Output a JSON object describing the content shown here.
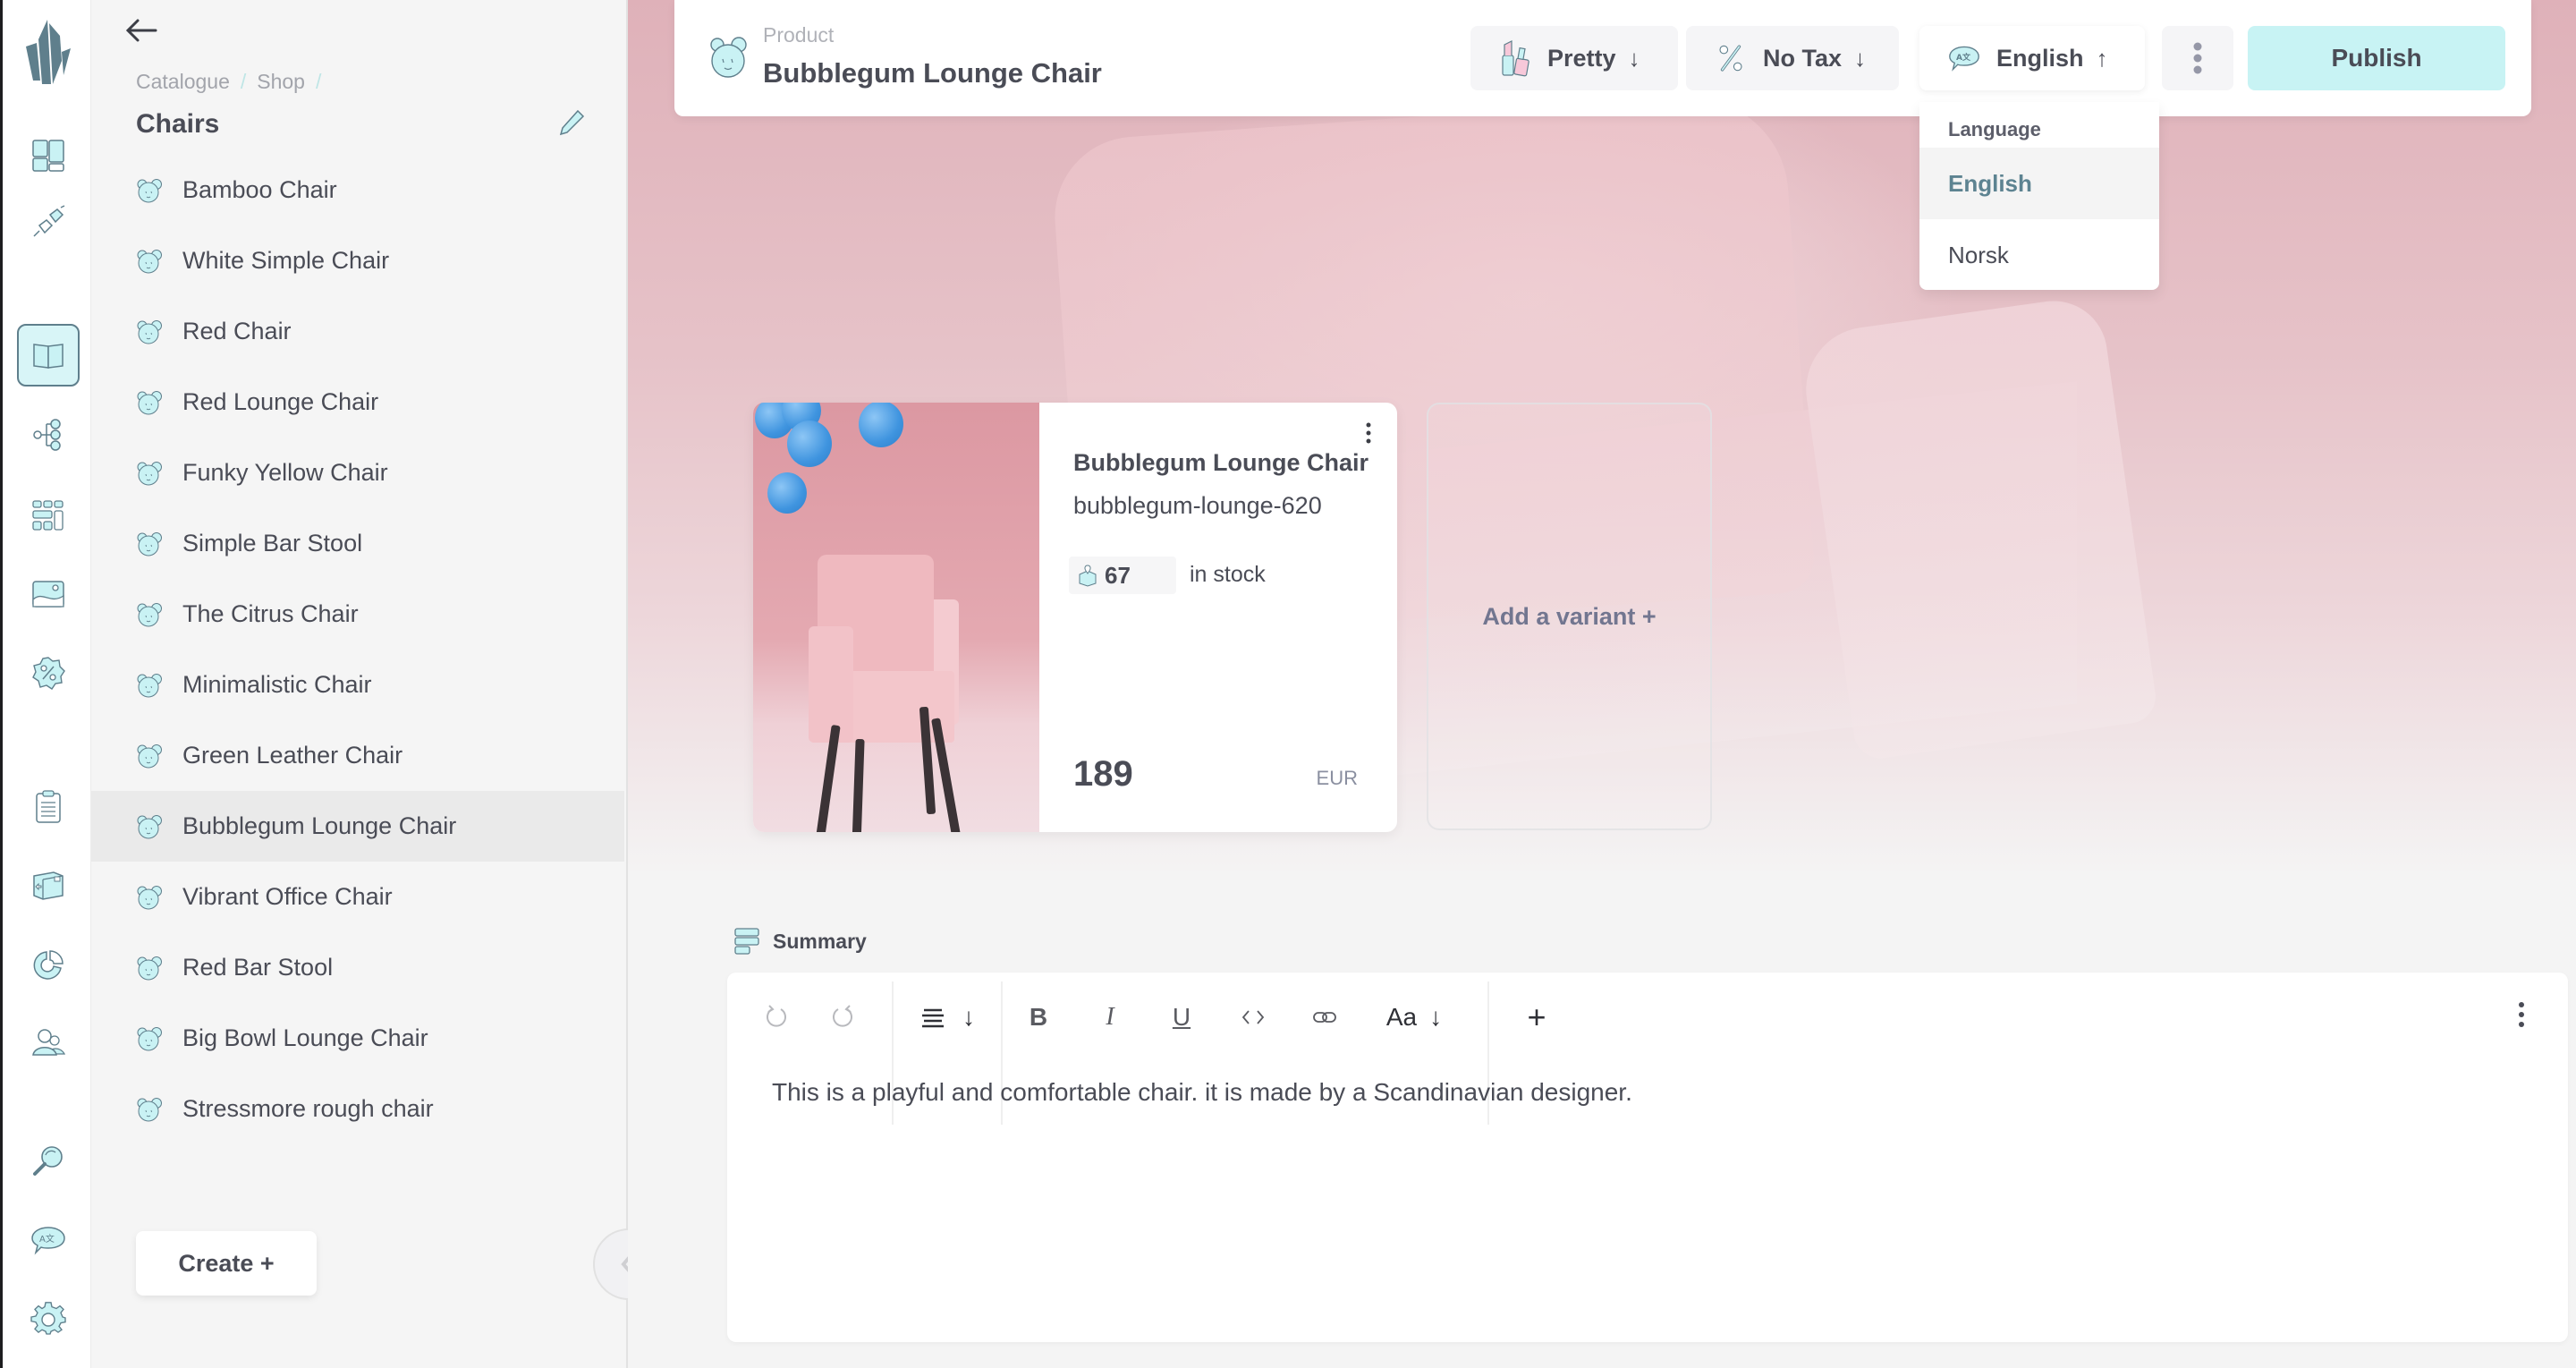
{
  "rail": {
    "items": [
      {
        "name": "dashboard",
        "active": false
      },
      {
        "name": "plugins",
        "active": false
      },
      {
        "name": "catalogue",
        "active": true
      },
      {
        "name": "topics",
        "active": false
      },
      {
        "name": "grids",
        "active": false
      },
      {
        "name": "media",
        "active": false
      },
      {
        "name": "discounts",
        "active": false
      },
      {
        "name": "orders",
        "active": false
      },
      {
        "name": "shipments",
        "active": false
      },
      {
        "name": "reports",
        "active": false
      },
      {
        "name": "customers",
        "active": false
      },
      {
        "name": "search",
        "active": false
      },
      {
        "name": "translations",
        "active": false
      },
      {
        "name": "settings",
        "active": false
      }
    ]
  },
  "sidebar": {
    "breadcrumb": [
      "Catalogue",
      "Shop"
    ],
    "breadcrumb_sep": "/",
    "folder_title": "Chairs",
    "items": [
      {
        "label": "Bamboo Chair",
        "selected": false
      },
      {
        "label": "White Simple Chair",
        "selected": false
      },
      {
        "label": "Red Chair",
        "selected": false
      },
      {
        "label": "Red Lounge Chair",
        "selected": false
      },
      {
        "label": "Funky Yellow Chair",
        "selected": false
      },
      {
        "label": "Simple Bar Stool",
        "selected": false
      },
      {
        "label": "The Citrus Chair",
        "selected": false
      },
      {
        "label": "Minimalistic Chair",
        "selected": false
      },
      {
        "label": "Green Leather Chair",
        "selected": false
      },
      {
        "label": "Bubblegum Lounge Chair",
        "selected": true
      },
      {
        "label": "Vibrant Office Chair",
        "selected": false
      },
      {
        "label": "Red Bar Stool",
        "selected": false
      },
      {
        "label": "Big Bowl Lounge Chair",
        "selected": false
      },
      {
        "label": "Stressmore rough chair",
        "selected": false
      }
    ],
    "create_label": "Create +"
  },
  "header": {
    "kind": "Product",
    "title": "Bubblegum Lounge Chair",
    "buttons": {
      "pretty": {
        "label": "Pretty",
        "arrow": "↓"
      },
      "tax": {
        "label": "No Tax",
        "arrow": "↓"
      },
      "language": {
        "label": "English",
        "arrow": "↑"
      },
      "publish": "Publish"
    }
  },
  "language_dropdown": {
    "label": "Language",
    "options": [
      {
        "label": "English",
        "selected": true
      },
      {
        "label": "Norsk",
        "selected": false
      }
    ]
  },
  "product_card": {
    "name": "Bubblegum Lounge Chair",
    "sku": "bubblegum-lounge-620",
    "stock": "67",
    "stock_label": "in stock",
    "price": "189",
    "currency": "EUR"
  },
  "variant_card": {
    "label": "Add a variant +"
  },
  "summary": {
    "label": "Summary",
    "toolbar": {
      "text_style": "Aa",
      "arrow": "↓",
      "bold": "B",
      "italic": "I",
      "underline": "U",
      "insert": "+"
    },
    "content": "This is a playful and comfortable chair. it is made by a Scandinavian designer."
  },
  "colors": {
    "accent": "#c8f3f4",
    "icon_fill": "#c9f2f4",
    "icon_stroke": "#5f7f8c",
    "text": "#4a4c56",
    "selected_row": "#eaeaea"
  }
}
